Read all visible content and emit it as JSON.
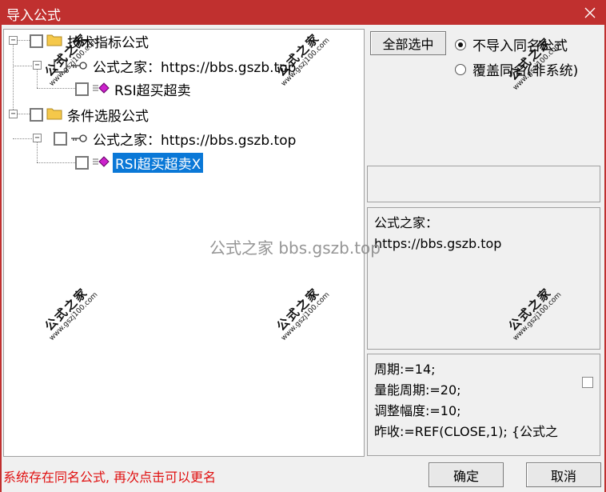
{
  "window": {
    "title": "导入公式",
    "title_bar_color": "#c0302f"
  },
  "tree": {
    "nodes": [
      {
        "label": "技术指标公式",
        "icon": "folder-icon",
        "checked": false,
        "expanded": true
      },
      {
        "label": "公式之家：https://bbs.gszb.top",
        "icon": "key-icon",
        "checked": false,
        "expanded": true
      },
      {
        "label": "RSI超买超卖",
        "icon": "formula-diamond-icon",
        "checked": false
      },
      {
        "label": "条件选股公式",
        "icon": "folder-icon",
        "checked": false,
        "expanded": true
      },
      {
        "label": "公式之家：https://bbs.gszb.top",
        "icon": "key-icon",
        "checked": false,
        "expanded": true
      },
      {
        "label": "RSI超买超卖X",
        "icon": "formula-diamond-icon",
        "checked": false,
        "selected": true
      }
    ]
  },
  "controls": {
    "select_all_label": "全部选中",
    "radio_no_import_label": "不导入同名公式",
    "radio_overwrite_label": "覆盖同名(非系统)",
    "selected_radio": "no_import"
  },
  "info": {
    "line1": "公式之家：",
    "line2": "https://bbs.gszb.top"
  },
  "code": {
    "lines": [
      "周期:=14;",
      "量能周期:=20;",
      "调整幅度:=10;",
      "昨收:=REF(CLOSE,1); {公式之"
    ]
  },
  "footer": {
    "status_text": "系统存在同名公式, 再次点击可以更名",
    "ok_label": "确定",
    "cancel_label": "取消",
    "status_color": "#e01010"
  },
  "watermarks": {
    "center_text": "公式之家 bbs.gszb.top",
    "stamp_title": "公式之家",
    "stamp_url": "www.gszj100.com"
  },
  "colors": {
    "selection": "#0a78d7",
    "folder": "#f5c84a",
    "diamond": "#cc22cc"
  }
}
